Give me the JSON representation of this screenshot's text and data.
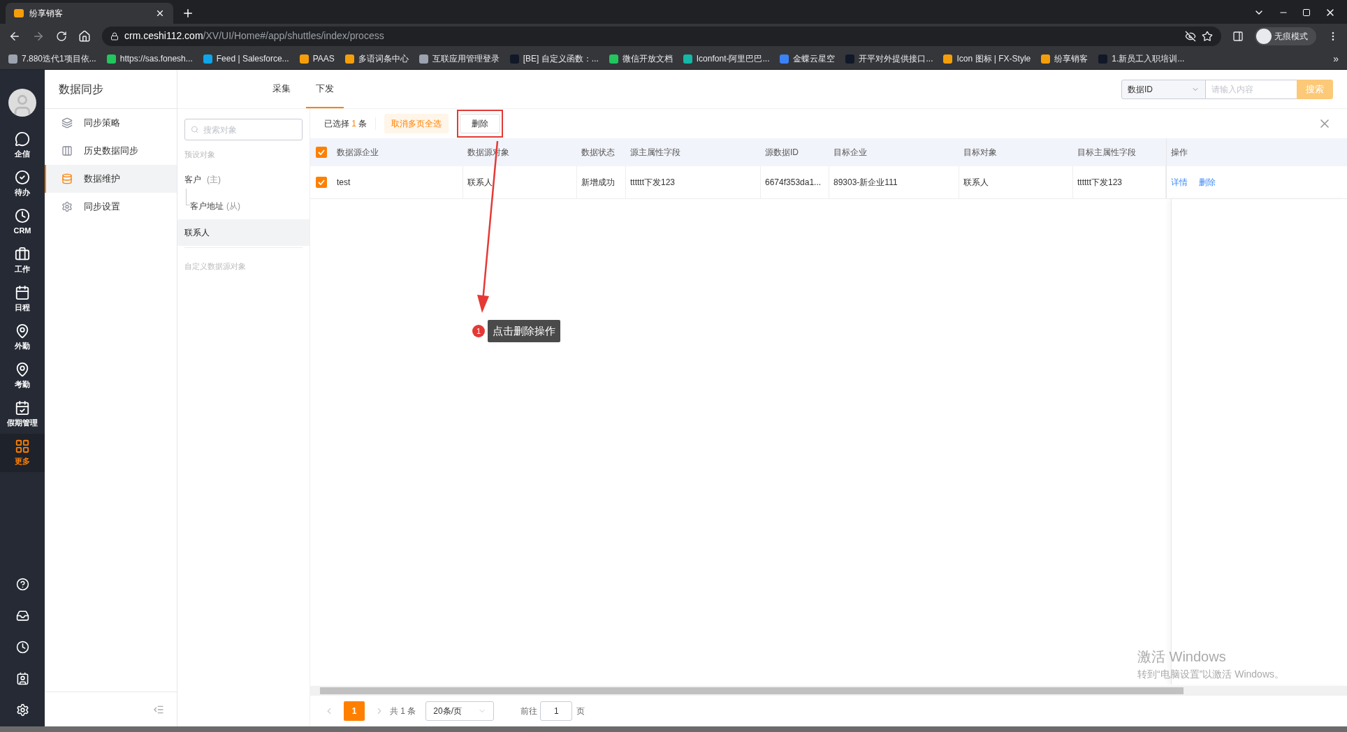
{
  "browser": {
    "tab_title": "纷享销客",
    "url_host": "crm.ceshi112.com",
    "url_path": "/XV/UI/Home#/app/shuttles/index/process",
    "profile_label": "无痕模式",
    "bookmarks": [
      {
        "label": "7.880迭代1项目依...",
        "color": "#9ca3af"
      },
      {
        "label": "https://sas.fonesh...",
        "color": "#22c55e"
      },
      {
        "label": "Feed | Salesforce...",
        "color": "#0ea5e9"
      },
      {
        "label": "PAAS",
        "color": "#f59e0b"
      },
      {
        "label": "多语词条中心",
        "color": "#f59e0b"
      },
      {
        "label": "互联应用管理登录",
        "color": "#9ca3af"
      },
      {
        "label": "[BE] 自定义函数：...",
        "color": "#111827"
      },
      {
        "label": "微信开放文档",
        "color": "#22c55e"
      },
      {
        "label": "Iconfont-阿里巴巴...",
        "color": "#14b8a6"
      },
      {
        "label": "金蝶云星空",
        "color": "#3b82f6"
      },
      {
        "label": "开平对外提供接口...",
        "color": "#111827"
      },
      {
        "label": "Icon 图标 | FX-Style",
        "color": "#f59e0b"
      },
      {
        "label": "纷享销客",
        "color": "#f59e0b"
      },
      {
        "label": "1.新员工入职培训...",
        "color": "#111827"
      }
    ],
    "more_bookmarks": "»"
  },
  "nav": {
    "items": [
      {
        "label": "企信",
        "kind": "chat",
        "selected": false
      },
      {
        "label": "待办",
        "kind": "todo",
        "selected": false
      },
      {
        "label": "CRM",
        "kind": "crm",
        "selected": false
      },
      {
        "label": "工作",
        "kind": "work",
        "selected": false
      },
      {
        "label": "日程",
        "kind": "calendar",
        "selected": false
      },
      {
        "label": "外勤",
        "kind": "pin",
        "selected": false
      },
      {
        "label": "考勤",
        "kind": "attendance",
        "selected": false
      },
      {
        "label": "假期管理",
        "kind": "leave",
        "selected": false
      },
      {
        "label": "更多",
        "kind": "more",
        "selected": true
      }
    ]
  },
  "sidebar": {
    "title": "数据同步",
    "items": [
      {
        "label": "同步策略",
        "kind": "layers",
        "selected": false
      },
      {
        "label": "历史数据同步",
        "kind": "history",
        "selected": false
      },
      {
        "label": "数据维护",
        "kind": "data",
        "selected": true
      },
      {
        "label": "同步设置",
        "kind": "settings",
        "selected": false
      }
    ]
  },
  "tabs": [
    {
      "label": "采集",
      "selected": false
    },
    {
      "label": "下发",
      "selected": true
    }
  ],
  "search": {
    "field": "数据ID",
    "placeholder": "请输入内容",
    "button": "搜索"
  },
  "objects": {
    "placeholder": "搜索对象",
    "preset_label": "预设对象",
    "items": [
      {
        "label": "客户",
        "tag": "(主)",
        "selected": false,
        "children": [
          {
            "label": "客户地址",
            "tag": "(从)",
            "selected": false
          }
        ]
      },
      {
        "label": "联系人",
        "selected": true
      }
    ],
    "custom_label": "自定义数据源对象"
  },
  "toolbar": {
    "selected_prefix": "已选择",
    "selected_count": "1",
    "selected_suffix": "条",
    "cancel_button": "取消多页全选",
    "delete_button": "删除"
  },
  "table": {
    "all_checked": true,
    "columns": [
      "数据源企业",
      "数据源对象",
      "数据状态",
      "源主属性字段",
      "源数据ID",
      "目标企业",
      "目标对象",
      "目标主属性字段",
      "操作"
    ],
    "rows": [
      {
        "checked": true,
        "cells": [
          "test",
          "联系人",
          "新增成功",
          "tttttt下发123",
          "6674f353da1...",
          "89303-新企业111",
          "联系人",
          "tttttt下发123"
        ],
        "actions": [
          "详情",
          "删除"
        ]
      }
    ]
  },
  "pagination": {
    "page": "1",
    "total": "共 1 条",
    "page_size": "20条/页",
    "goto_label": "前往",
    "goto_value": "1",
    "page_suffix": "页"
  },
  "annotation": {
    "number": "1",
    "text": "点击删除操作"
  },
  "os_watermark": {
    "title": "激活 Windows",
    "hint": "转到“电脑设置”以激活 Windows。"
  }
}
